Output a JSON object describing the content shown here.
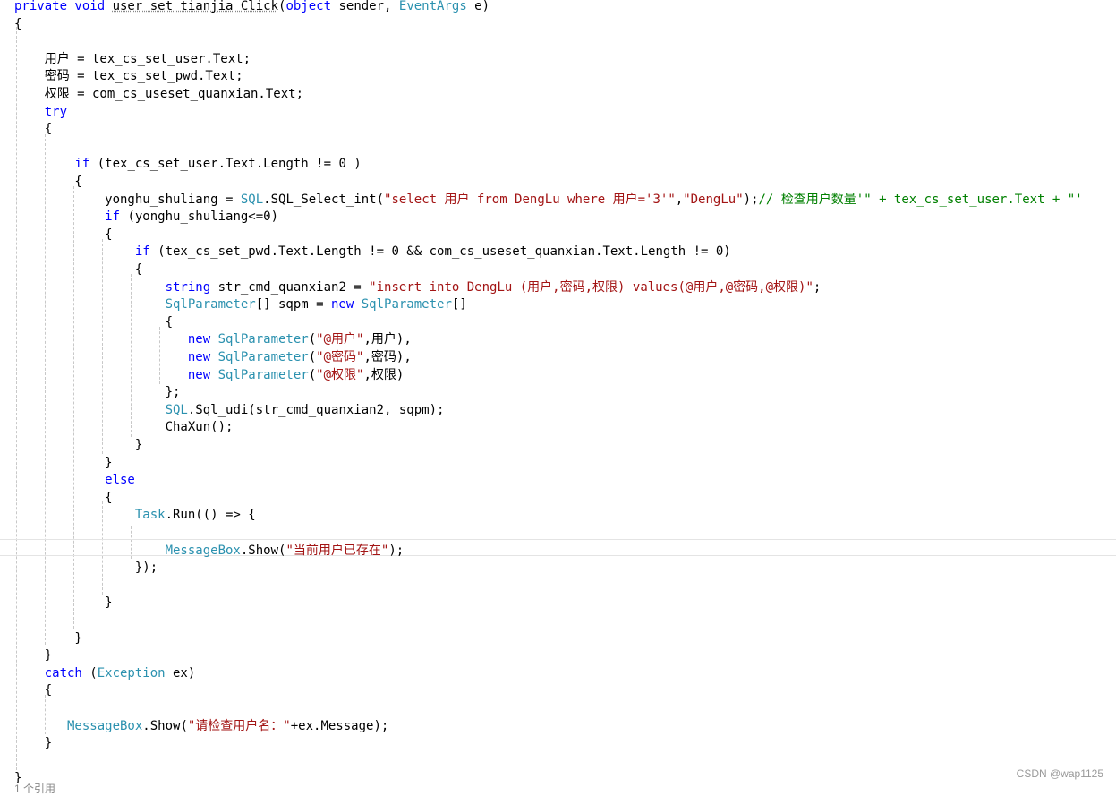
{
  "editor": {
    "lines": [
      [
        [
          "kw",
          "private void "
        ],
        [
          "pl",
          "user_set_tianjia_Click"
        ],
        [
          "pl",
          "("
        ],
        [
          "kw",
          "object"
        ],
        [
          "pl",
          " sender, "
        ],
        [
          "ty",
          "EventArgs"
        ],
        [
          "pl",
          " e)"
        ]
      ],
      [
        [
          "pl",
          "{"
        ]
      ],
      [],
      [
        [
          "pl",
          "    用户 = tex_cs_set_user.Text;"
        ]
      ],
      [
        [
          "pl",
          "    密码 = tex_cs_set_pwd.Text;"
        ]
      ],
      [
        [
          "pl",
          "    权限 = com_cs_useset_quanxian.Text;"
        ]
      ],
      [
        [
          "kw",
          "    try"
        ]
      ],
      [
        [
          "pl",
          "    {"
        ]
      ],
      [],
      [
        [
          "kw",
          "        if"
        ],
        [
          "pl",
          " (tex_cs_set_user.Text.Length != 0 )"
        ]
      ],
      [
        [
          "pl",
          "        {"
        ]
      ],
      [
        [
          "pl",
          "            yonghu_shuliang = "
        ],
        [
          "ty",
          "SQL"
        ],
        [
          "pl",
          "."
        ],
        [
          "pl",
          "SQL_Select_int("
        ],
        [
          "st",
          "\"select 用户 from DengLu where 用户='3'\""
        ],
        [
          "pl",
          ","
        ],
        [
          "st",
          "\"DengLu\""
        ],
        [
          "pl",
          ");"
        ],
        [
          "cm",
          "// 检查用户数量'\" + tex_cs_set_user.Text + \"'"
        ]
      ],
      [
        [
          "kw",
          "            if"
        ],
        [
          "pl",
          " (yonghu_shuliang<=0)"
        ]
      ],
      [
        [
          "pl",
          "            {"
        ]
      ],
      [
        [
          "kw",
          "                if"
        ],
        [
          "pl",
          " (tex_cs_set_pwd.Text.Length != 0 && com_cs_useset_quanxian.Text.Length != 0)"
        ]
      ],
      [
        [
          "pl",
          "                {"
        ]
      ],
      [
        [
          "kw",
          "                    string"
        ],
        [
          "pl",
          " str_cmd_quanxian2 = "
        ],
        [
          "st",
          "\"insert into DengLu (用户,密码,权限) values(@用户,@密码,@权限)\""
        ],
        [
          "pl",
          ";"
        ]
      ],
      [
        [
          "ty",
          "                    SqlParameter"
        ],
        [
          "pl",
          "[] sqpm = "
        ],
        [
          "kw",
          "new "
        ],
        [
          "ty",
          "SqlParameter"
        ],
        [
          "pl",
          "[]"
        ]
      ],
      [
        [
          "pl",
          "                    {"
        ]
      ],
      [
        [
          "kw",
          "                       new "
        ],
        [
          "ty",
          "SqlParameter"
        ],
        [
          "pl",
          "("
        ],
        [
          "st",
          "\"@用户\""
        ],
        [
          "pl",
          ",用户),"
        ]
      ],
      [
        [
          "kw",
          "                       new "
        ],
        [
          "ty",
          "SqlParameter"
        ],
        [
          "pl",
          "("
        ],
        [
          "st",
          "\"@密码\""
        ],
        [
          "pl",
          ",密码),"
        ]
      ],
      [
        [
          "kw",
          "                       new "
        ],
        [
          "ty",
          "SqlParameter"
        ],
        [
          "pl",
          "("
        ],
        [
          "st",
          "\"@权限\""
        ],
        [
          "pl",
          ",权限)"
        ]
      ],
      [
        [
          "pl",
          "                    };"
        ]
      ],
      [
        [
          "ty",
          "                    SQL"
        ],
        [
          "pl",
          ".Sql_udi(str_cmd_quanxian2, sqpm);"
        ]
      ],
      [
        [
          "pl",
          "                    ChaXun();"
        ]
      ],
      [
        [
          "pl",
          "                }"
        ]
      ],
      [
        [
          "pl",
          "            }"
        ]
      ],
      [
        [
          "kw",
          "            else"
        ]
      ],
      [
        [
          "pl",
          "            {"
        ]
      ],
      [
        [
          "ty",
          "                Task"
        ],
        [
          "pl",
          ".Run(() => {"
        ]
      ],
      [],
      [
        [
          "ty",
          "                    MessageBox"
        ],
        [
          "pl",
          ".Show("
        ],
        [
          "st",
          "\"当前用户已存在\""
        ],
        [
          "pl",
          ");"
        ]
      ],
      [
        [
          "pl",
          "                });"
        ]
      ],
      [],
      [
        [
          "pl",
          "            }"
        ]
      ],
      [],
      [
        [
          "pl",
          "        }"
        ]
      ],
      [
        [
          "pl",
          "    }"
        ]
      ],
      [
        [
          "kw",
          "    catch"
        ],
        [
          "pl",
          " ("
        ],
        [
          "ty",
          "Exception"
        ],
        [
          "pl",
          " ex)"
        ]
      ],
      [
        [
          "pl",
          "    {"
        ]
      ],
      [],
      [
        [
          "ty",
          "       MessageBox"
        ],
        [
          "pl",
          ".Show("
        ],
        [
          "st",
          "\"请检查用户名：\""
        ],
        [
          "pl",
          "+ex.Message);"
        ]
      ],
      [
        [
          "pl",
          "    }"
        ]
      ],
      [],
      [
        [
          "pl",
          "}"
        ]
      ]
    ],
    "ref_hint": "1 个引用"
  },
  "watermark": "CSDN @wap1125",
  "colors": {
    "keyword": "#0000ff",
    "type": "#2b91af",
    "string": "#a31515",
    "comment": "#008000"
  }
}
